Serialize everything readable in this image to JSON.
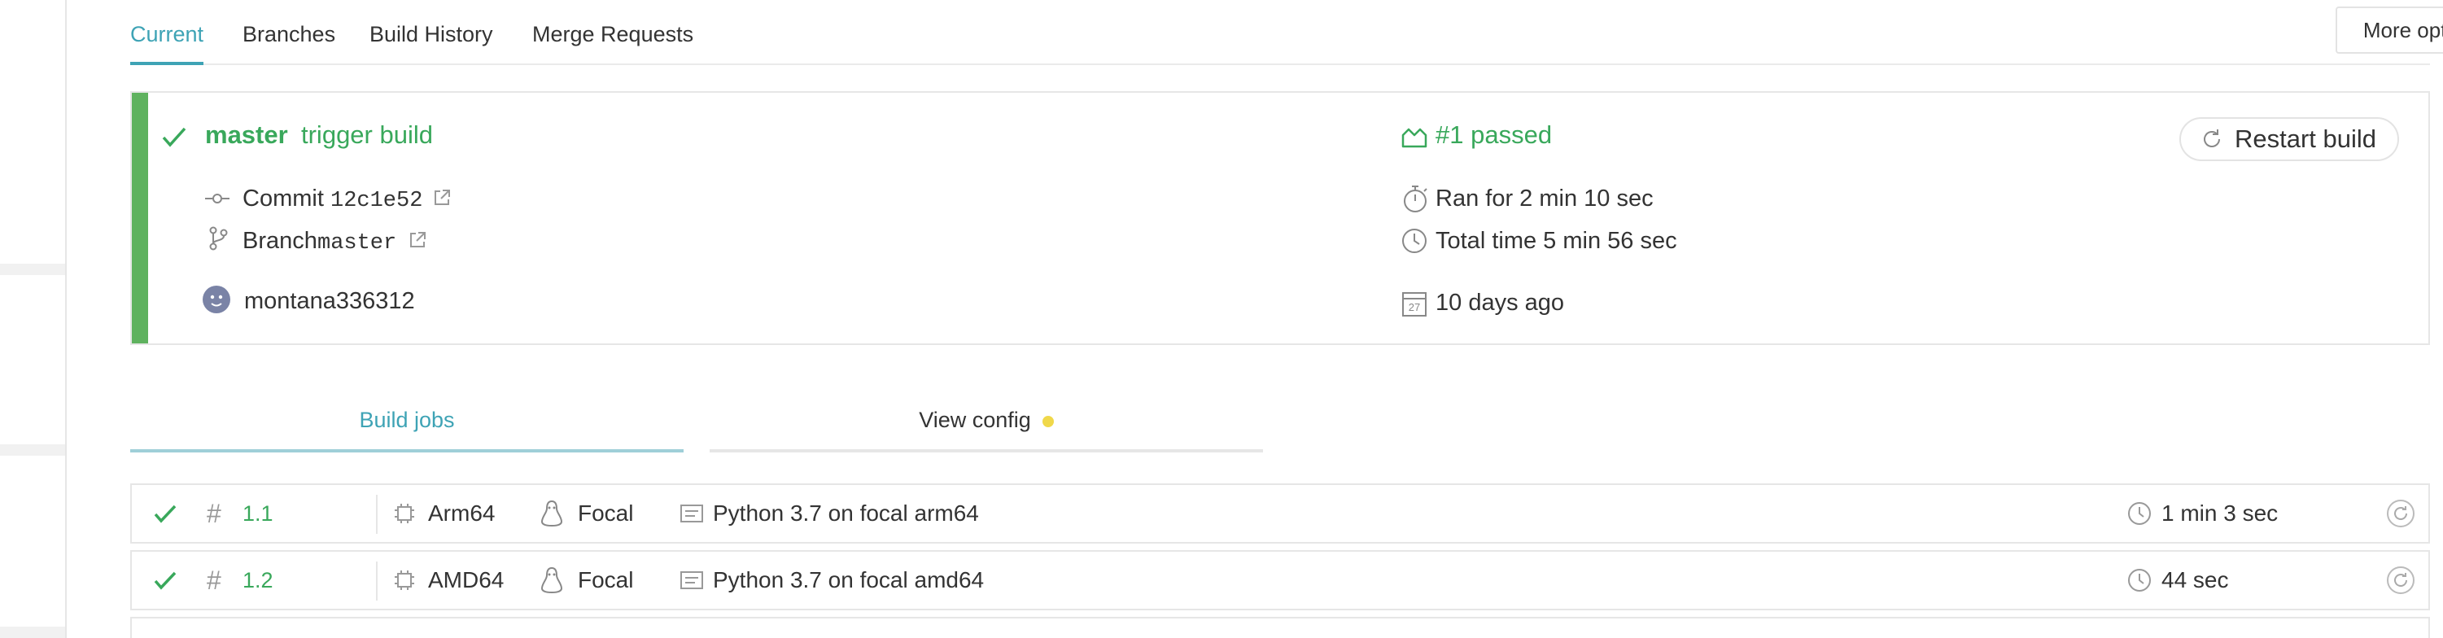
{
  "tabs": {
    "current": "Current",
    "branches": "Branches",
    "build_history": "Build History",
    "merge_requests": "Merge Requests"
  },
  "more_options": {
    "label": "More options"
  },
  "build": {
    "branch": "master",
    "trigger": "trigger build",
    "number_status": "#1 passed",
    "restart_label": "Restart build",
    "commit_label": "Commit",
    "commit_sha": "12c1e52",
    "branch_label": "Branch",
    "branch_name": "master",
    "ran_for": "Ran for 2 min 10 sec",
    "total_time": "Total time 5 min 56 sec",
    "author": "montana336312",
    "age": "10 days ago",
    "calendar_day": "27"
  },
  "job_tabs": {
    "build_jobs": "Build jobs",
    "view_config": "View config"
  },
  "jobs": [
    {
      "number": "1.1",
      "arch": "Arm64",
      "os": "Focal",
      "name": "Python 3.7 on focal arm64",
      "duration": "1 min 3 sec"
    },
    {
      "number": "1.2",
      "arch": "AMD64",
      "os": "Focal",
      "name": "Python 3.7 on focal amd64",
      "duration": "44 sec"
    }
  ],
  "colors": {
    "accent": "#3ea3b5",
    "passed": "#39a85b",
    "stripe": "#5fb25f",
    "warning_dot": "#f0d84a"
  }
}
